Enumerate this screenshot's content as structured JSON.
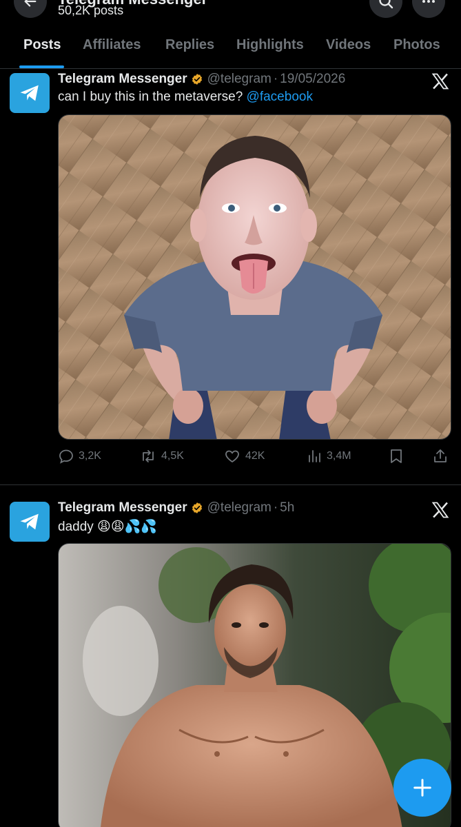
{
  "header": {
    "title": "Telegram Messenger",
    "post_count": "50,2K posts"
  },
  "tabs": [
    {
      "label": "Posts",
      "active": true
    },
    {
      "label": "Affiliates"
    },
    {
      "label": "Replies"
    },
    {
      "label": "Highlights"
    },
    {
      "label": "Videos"
    },
    {
      "label": "Photos"
    }
  ],
  "tweets": [
    {
      "display_name": "Telegram Messenger",
      "handle": "@telegram",
      "separator": "·",
      "time": "19/05/2026",
      "text": "can I buy this in the metaverse?",
      "mention": "@facebook",
      "image_alt": "Man in blue t-shirt sticking out tongue, photographed from above on wooden floor",
      "stats": {
        "replies": "3,2K",
        "reposts": "4,5K",
        "likes": "42K",
        "views": "3,4M"
      }
    },
    {
      "display_name": "Telegram Messenger",
      "handle": "@telegram",
      "separator": "·",
      "time": "5h",
      "text": "daddy 😩😩💦💦",
      "image_alt": "Shirtless man with dark hair standing in front of greenery"
    }
  ],
  "colors": {
    "background": "#000000",
    "accent": "#1d9bf0",
    "muted": "#71767b",
    "text": "#e7e9ea",
    "telegram": "#2aa3df",
    "verified": "#e8a72a"
  }
}
